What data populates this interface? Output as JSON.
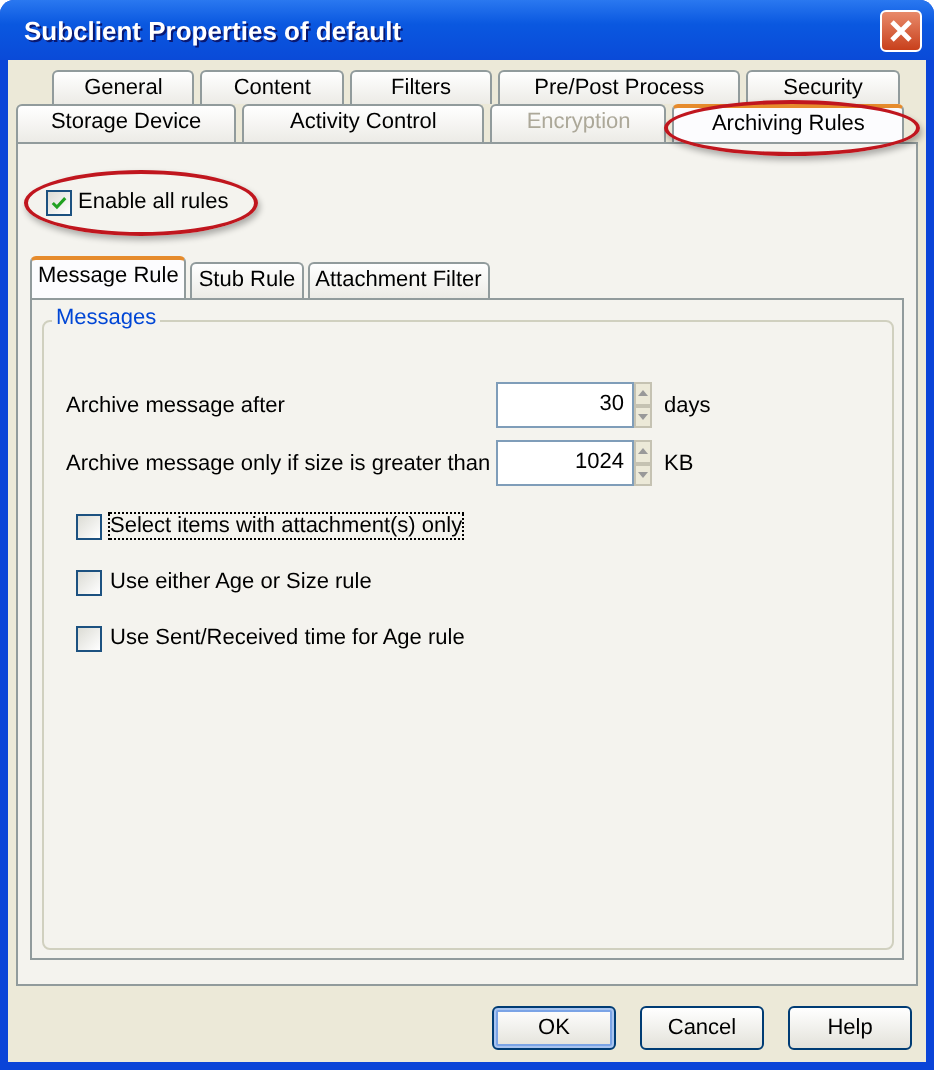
{
  "window": {
    "title": "Subclient Properties of default"
  },
  "tab_rows": [
    {
      "tabs": [
        {
          "label": "General",
          "selected": false,
          "disabled": false,
          "annotated": false
        },
        {
          "label": "Content",
          "selected": false,
          "disabled": false,
          "annotated": false
        },
        {
          "label": "Filters",
          "selected": false,
          "disabled": false,
          "annotated": false
        },
        {
          "label": "Pre/Post Process",
          "selected": false,
          "disabled": false,
          "annotated": false
        },
        {
          "label": "Security",
          "selected": false,
          "disabled": false,
          "annotated": false
        }
      ]
    },
    {
      "tabs": [
        {
          "label": "Storage Device",
          "selected": false,
          "disabled": false,
          "annotated": false
        },
        {
          "label": "Activity Control",
          "selected": false,
          "disabled": false,
          "annotated": false
        },
        {
          "label": "Encryption",
          "selected": false,
          "disabled": true,
          "annotated": false
        },
        {
          "label": "Archiving Rules",
          "selected": true,
          "disabled": false,
          "annotated": true
        }
      ]
    }
  ],
  "enable_all": {
    "label": "Enable all rules",
    "checked": true,
    "annotated": true
  },
  "sub_tabs": [
    {
      "label": "Message Rule",
      "selected": true
    },
    {
      "label": "Stub Rule",
      "selected": false
    },
    {
      "label": "Attachment Filter",
      "selected": false
    }
  ],
  "group": {
    "title": "Messages",
    "fields": [
      {
        "label": "Archive message after",
        "value": "30",
        "unit": "days"
      },
      {
        "label": "Archive message only if size is greater than",
        "value": "1024",
        "unit": "KB"
      }
    ],
    "options": [
      {
        "label": "Select items with attachment(s) only",
        "checked": false,
        "focused": true
      },
      {
        "label": "Use either Age or Size rule",
        "checked": false,
        "focused": false
      },
      {
        "label": "Use Sent/Received time for Age rule",
        "checked": false,
        "focused": false
      }
    ]
  },
  "buttons": [
    {
      "label": "OK",
      "default": true
    },
    {
      "label": "Cancel",
      "default": false
    },
    {
      "label": "Help",
      "default": false
    }
  ]
}
